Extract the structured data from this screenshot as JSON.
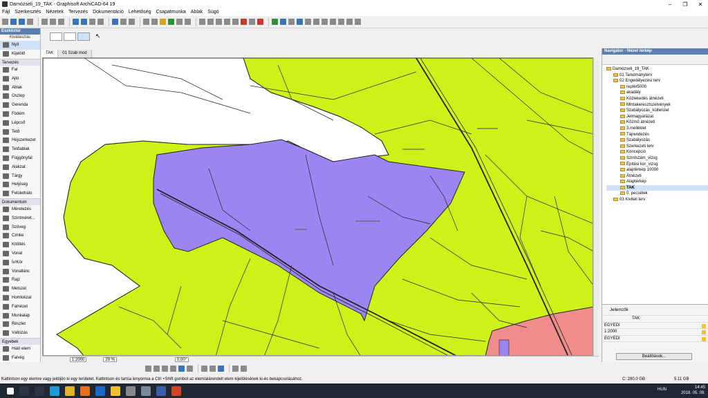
{
  "window": {
    "title": "Darnózseli_19_TAK - Graphisoft ArchiCAD-64 19",
    "controls": [
      "–",
      "❐",
      "✕"
    ]
  },
  "menu": [
    "Fájl",
    "Szerkesztés",
    "Nézetek",
    "Tervezés",
    "Dokumentáció",
    "Lehetőség",
    "Csapatmunka",
    "Ablak",
    "Súgó"
  ],
  "toolbox": {
    "title": "Eszköztár",
    "select_label": "Kiválasztás",
    "items_top": [
      "Nyíl",
      "Kijelölő"
    ],
    "sections": [
      {
        "name": "Tervezés",
        "items": [
          "Fal",
          "Ajtó",
          "Ablak",
          "Oszlop",
          "Gerenda",
          "Födém",
          "Lépcső",
          "Tető",
          "Héjszerkezet",
          "Tetőablak",
          "Függönyfal",
          "Alakzat",
          "Tárgy",
          "Helyiség",
          "Felülethálo"
        ]
      },
      {
        "name": "Dokumentum",
        "items": [
          "Méretezés",
          "Szintméret...",
          "Szöveg",
          "Címke",
          "Kitöltés",
          "Vonal",
          "Ív/Kör",
          "Vonallánc",
          "Rajz",
          "Metszet",
          "Homlokzat",
          "Falnézet",
          "Munkalap",
          "Részlet",
          "Változás"
        ]
      },
      {
        "name": "Egyebek",
        "items": [
          "Háló elem",
          "Falvég"
        ]
      }
    ]
  },
  "tabs": [
    "TAK",
    "01 Szab mod"
  ],
  "quickbar": {
    "scale": "1:2000",
    "zoom": "29 %",
    "angle": "0,00°"
  },
  "navigator": {
    "title": "Navigátor - Nézet térkép",
    "root": "Darnózseli_19_TAK",
    "nodes": [
      {
        "label": "01 Tanulmányterv",
        "level": 1
      },
      {
        "label": "02 Engedélyezési terv",
        "level": 1
      },
      {
        "label": "reptér5000",
        "level": 2
      },
      {
        "label": "akadály",
        "level": 2
      },
      {
        "label": "Közlekedés átnézeti",
        "level": 2
      },
      {
        "label": "Mintakeresztszelvények",
        "level": 2
      },
      {
        "label": "Szabályozás_külterület",
        "level": 2
      },
      {
        "label": "Jelmagyarázat",
        "level": 2
      },
      {
        "label": "Közmű átnézeti",
        "level": 2
      },
      {
        "label": "3.melléklet",
        "level": 2
      },
      {
        "label": "Tájrendezés",
        "level": 2
      },
      {
        "label": "Szabályozás",
        "level": 2
      },
      {
        "label": "Szerkezeti terv",
        "level": 2
      },
      {
        "label": "Koncepció",
        "level": 2
      },
      {
        "label": "Szintszám_vizsg",
        "level": 2
      },
      {
        "label": "Építési kor_vizsg",
        "level": 2
      },
      {
        "label": "alaptérkép 10000",
        "level": 2
      },
      {
        "label": "Átnézeti",
        "level": 2
      },
      {
        "label": "Alaptérkép",
        "level": 2
      },
      {
        "label": "TAK",
        "level": 2,
        "selected": true
      },
      {
        "label": "0. pecsétek",
        "level": 2
      },
      {
        "label": "03 Kiviteli terv",
        "level": 1
      }
    ]
  },
  "properties": {
    "title": "Jellemzők",
    "name_value": "TAK",
    "layer1": "EGYEDI",
    "scale": "1:2000",
    "layer2": "EGYEDI",
    "settings_button": "Beállítások..."
  },
  "status": {
    "hint": "Kattintson egy elemre vagy jelöljön ki egy területet. Kattintson és tartsa lenyomva a Ctrl +Shift gombot az elem/alárendelt elem kijelölésének ki-és bekapcsolásához.",
    "disk": "C: 280.0 GB",
    "memory": "5.11 GB"
  },
  "taskbar": {
    "lang": "HUN",
    "time": "14:45",
    "date": "2018. 05. 09."
  },
  "colors": {
    "land": "#ccf21a",
    "purple": "#9b85f2",
    "pink": "#f08c8c",
    "accent": "#5b7fb0"
  }
}
